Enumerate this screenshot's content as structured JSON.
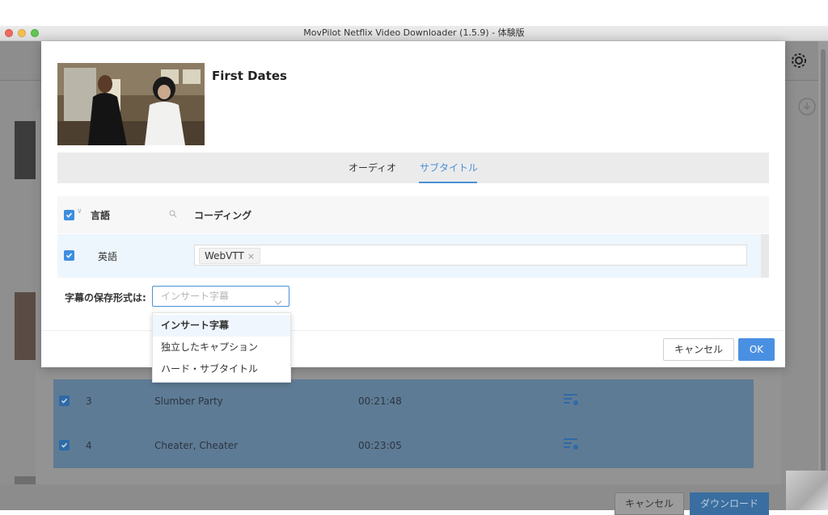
{
  "window": {
    "title": "MovPilot Netflix Video Downloader (1.5.9) - 体験版"
  },
  "background": {
    "episodes": [
      {
        "number": "3",
        "title": "Slumber Party",
        "duration": "00:21:48"
      },
      {
        "number": "4",
        "title": "Cheater, Cheater",
        "duration": "00:23:05"
      }
    ],
    "cancel_label": "キャンセル",
    "download_label": "ダウンロード"
  },
  "modal": {
    "movie_title": "First Dates",
    "tabs": [
      {
        "label": "オーディオ",
        "active": false
      },
      {
        "label": "サブタイトル",
        "active": true
      }
    ],
    "table": {
      "col_language": "言語",
      "col_coding": "コーディング",
      "rows": [
        {
          "language": "英語",
          "coding_chip": "WebVTT",
          "chip_remove": "×",
          "checked": true
        }
      ]
    },
    "save_format": {
      "label": "字幕の保存形式は:",
      "placeholder": "インサート字幕",
      "options": [
        "インサート字幕",
        "独立したキャプション",
        "ハード・サブタイトル"
      ],
      "highlighted_option": 0
    },
    "cancel_label": "キャンセル",
    "ok_label": "OK"
  },
  "colors": {
    "accent": "#4a90d9",
    "checkbox": "#3d8ee0",
    "ok_button": "#4a90e2"
  }
}
